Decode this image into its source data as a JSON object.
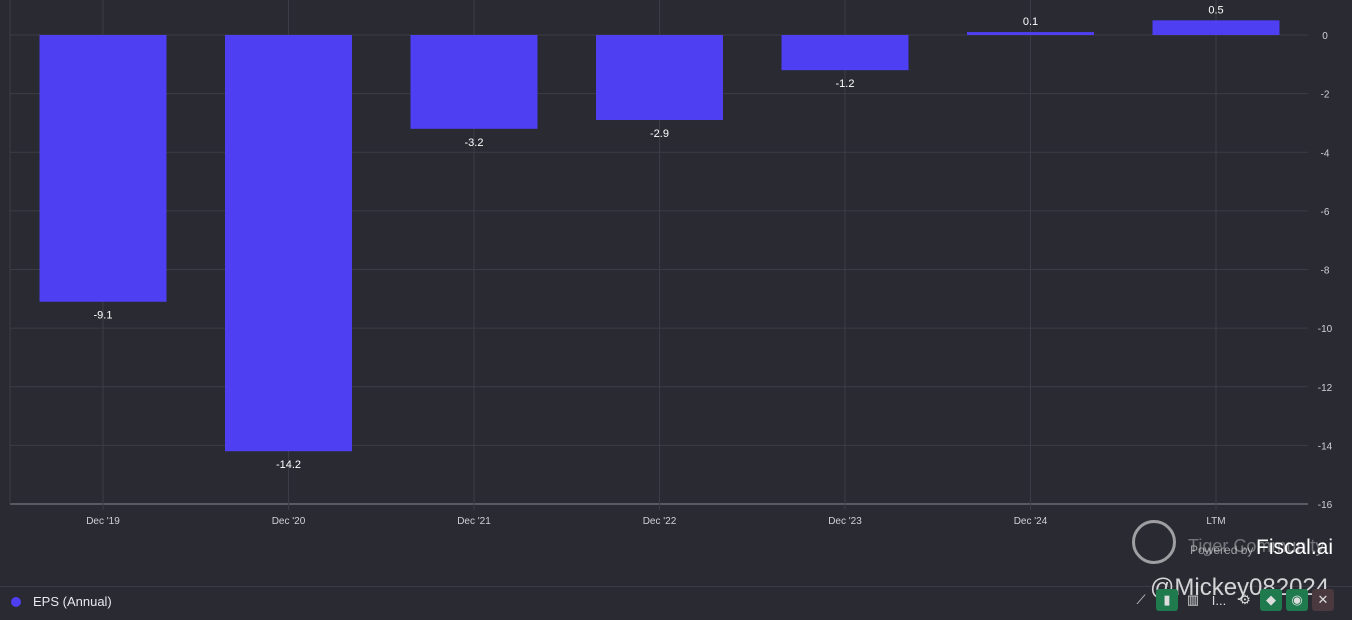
{
  "chart_data": {
    "type": "bar",
    "categories": [
      "Dec '19",
      "Dec '20",
      "Dec '21",
      "Dec '22",
      "Dec '23",
      "Dec '24",
      "LTM"
    ],
    "series": [
      {
        "name": "EPS (Annual)",
        "values": [
          -9.1,
          -14.2,
          -3.2,
          -2.9,
          -1.2,
          0.1,
          0.5
        ]
      }
    ],
    "data_labels": [
      "-9.1",
      "-14.2",
      "-3.2",
      "-2.9",
      "-1.2",
      "0.1",
      "0.5"
    ],
    "ylim": [
      -16,
      0.8
    ],
    "yticks": [
      0,
      -2,
      -4,
      -6,
      -8,
      -10,
      -12,
      -14,
      -16
    ],
    "y_axis_position": "right",
    "grid": true,
    "legend_position": "bottom-left",
    "colors": {
      "bar": "#4f3ff2",
      "background": "#2a2a33",
      "grid": "#3c3c46",
      "text": "#d0d0d8"
    }
  },
  "legend": {
    "label": "EPS (Annual)"
  },
  "watermark": {
    "powered_by": "Powered by",
    "brand": "Fiscal.ai",
    "community": "Tiger Community",
    "user": "@Mickey082024"
  },
  "toolbar": {
    "icons": [
      "line-chart-icon",
      "bar-chart-icon",
      "stacked-bar-icon",
      "more-icon",
      "gear-icon",
      "tag-icon",
      "eye-icon",
      "close-icon"
    ],
    "more_label": "I..."
  }
}
